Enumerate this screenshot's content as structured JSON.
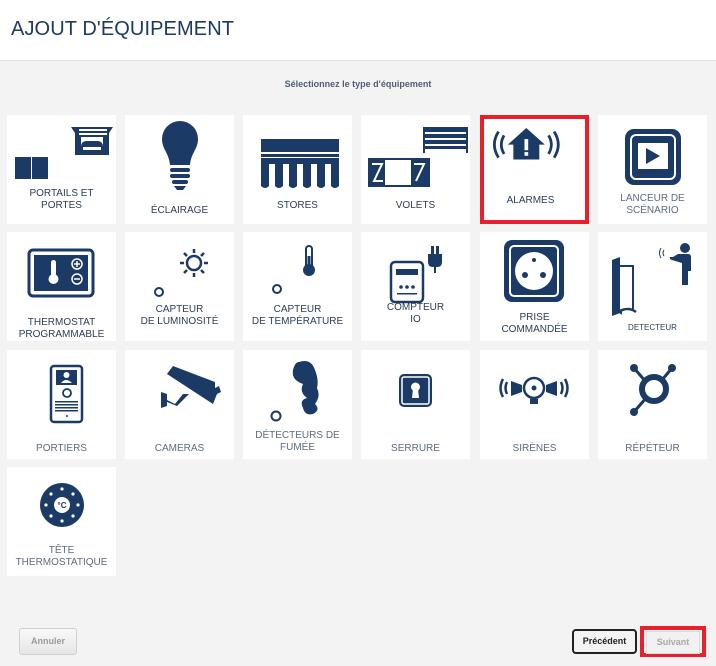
{
  "header": {
    "title": "AJOUT D'ÉQUIPEMENT"
  },
  "subtitle": "Sélectionnez le type d'équipement",
  "colors": {
    "icon": "#1b3a66",
    "selection": "#e8202a",
    "label": "#2c3e57"
  },
  "tiles": [
    {
      "label_lines": [
        "PORTAILS ET",
        "PORTES"
      ],
      "icon": "gate-garage-icon",
      "selected": false
    },
    {
      "label_lines": [
        "ÉCLAIRAGE"
      ],
      "icon": "light-bulb-icon",
      "selected": false
    },
    {
      "label_lines": [
        "STORES"
      ],
      "icon": "awning-icon",
      "selected": false
    },
    {
      "label_lines": [
        "VOLETS"
      ],
      "icon": "shutters-icon",
      "selected": false
    },
    {
      "label_lines": [
        "ALARMES"
      ],
      "icon": "alarm-house-icon",
      "selected": true
    },
    {
      "label_lines": [
        "LANCEUR DE",
        "SCÉNARIO"
      ],
      "icon": "scenario-play-icon",
      "selected": false
    },
    {
      "label_lines": [
        "THERMOSTAT",
        "PROGRAMMABLE"
      ],
      "icon": "thermostat-icon",
      "selected": false
    },
    {
      "label_lines": [
        "CAPTEUR",
        "DE LUMINOSITÉ"
      ],
      "icon": "sun-sensor-icon",
      "selected": false
    },
    {
      "label_lines": [
        "CAPTEUR",
        "DE TEMPÉRATURE"
      ],
      "icon": "thermometer-sensor-icon",
      "selected": false
    },
    {
      "label_lines": [
        "COMPTEUR",
        "IO"
      ],
      "icon": "energy-meter-icon",
      "selected": false
    },
    {
      "label_lines": [
        "PRISE",
        "COMMANDÉE"
      ],
      "icon": "power-socket-icon",
      "selected": false
    },
    {
      "label_lines": [
        "DETECTEUR"
      ],
      "icon": "motion-detector-icon",
      "selected": false
    },
    {
      "label_lines": [
        "PORTIERS"
      ],
      "icon": "door-intercom-icon",
      "selected": false
    },
    {
      "label_lines": [
        "CAMERAS"
      ],
      "icon": "security-camera-icon",
      "selected": false
    },
    {
      "label_lines": [
        "DÉTECTEURS DE",
        "FUMÉE"
      ],
      "icon": "smoke-detector-icon",
      "selected": false
    },
    {
      "label_lines": [
        "SERRURE"
      ],
      "icon": "lock-icon",
      "selected": false
    },
    {
      "label_lines": [
        "SIRÈNES"
      ],
      "icon": "siren-icon",
      "selected": false
    },
    {
      "label_lines": [
        "RÉPÉTEUR"
      ],
      "icon": "repeater-icon",
      "selected": false
    },
    {
      "label_lines": [
        "TÊTE",
        "THERMOSTATIQUE"
      ],
      "icon": "thermostatic-head-icon",
      "selected": false
    }
  ],
  "footer": {
    "cancel_label": "Annuler",
    "previous_label": "Précédent",
    "next_label": "Suivant",
    "next_disabled": true
  }
}
